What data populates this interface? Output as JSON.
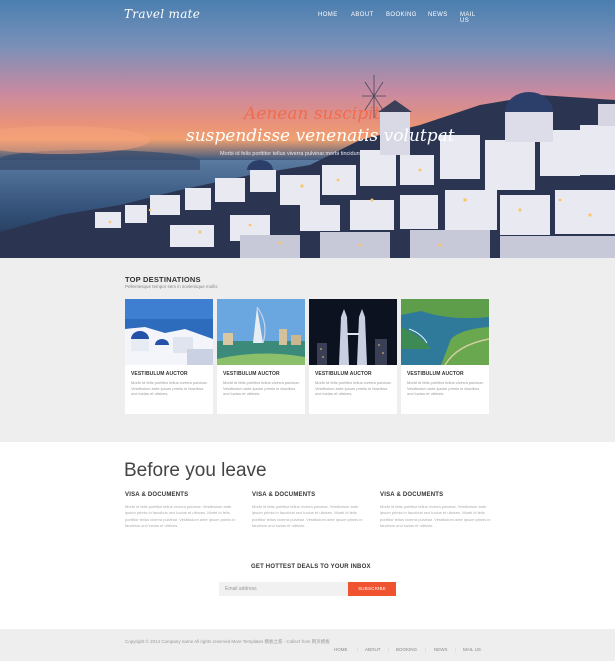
{
  "header": {
    "logo": "Travel mate",
    "nav": [
      "HOME",
      "ABOUT",
      "BOOKING",
      "NEWS",
      "MAIL US"
    ]
  },
  "hero": {
    "title_line1": "Aenean suscipit",
    "title_line2": "suspendisse venenatis volutpat",
    "subtitle": "Morbi id felis porttitor tellus viverra pulvinar.morbi tincidunt"
  },
  "destinations": {
    "title": "TOP DESTINATIONS",
    "subtitle": "Pellentesque tempor sem in scelerisque mollis",
    "cards": [
      {
        "title": "VESTIBULUM AUCTOR",
        "text": "Morbi id felis porttitor tellus viverra pulvinar. Vestibulum ante ipsum primis in faucibus orci luctus et ultrices."
      },
      {
        "title": "VESTIBULUM AUCTOR",
        "text": "Morbi id felis porttitor tellus viverra pulvinar. Vestibulum ante ipsum primis in faucibus orci luctus et ultrices."
      },
      {
        "title": "VESTIBULUM AUCTOR",
        "text": "Morbi id felis porttitor tellus viverra pulvinar. Vestibulum ante ipsum primis in faucibus orci luctus et ultrices."
      },
      {
        "title": "VESTIBULUM AUCTOR",
        "text": "Morbi id felis porttitor tellus viverra pulvinar. Vestibulum ante ipsum primis in faucibus orci luctus et ultrices."
      }
    ]
  },
  "leave": {
    "title": "Before you leave",
    "columns": [
      {
        "heading": "VISA & DOCUMENTS",
        "text": "Morbi id felis porttitor tellus viverra pulvinar. Vestibulum ante ipsum primis in faucibus orci luctus et ultrices. Morbi id felis porttitor tellus viverra pulvinar. Vestibulum ante ipsum primis in faucibus orci luctus et ultrices."
      },
      {
        "heading": "VISA & DOCUMENTS",
        "text": "Morbi id felis porttitor tellus viverra pulvinar. Vestibulum ante ipsum primis in faucibus orci luctus et ultrices. Morbi id felis porttitor tellus viverra pulvinar. Vestibulum ante ipsum primis in faucibus orci luctus et ultrices."
      },
      {
        "heading": "VISA & DOCUMENTS",
        "text": "Morbi id felis porttitor tellus viverra pulvinar. Vestibulum ante ipsum primis in faucibus orci luctus et ultrices. Morbi id felis porttitor tellus viverra pulvinar. Vestibulum ante ipsum primis in faucibus orci luctus et ultrices."
      }
    ]
  },
  "newsletter": {
    "title": "GET HOTTEST DEALS TO YOUR INBOX",
    "placeholder": "Email address",
    "button": "SUBSCRIBE"
  },
  "footer": {
    "copyright": "Copyright © 2014 Company name All rights reserved  More Templates 模板之家  -  Collect from 网页模板",
    "nav": [
      "HOME",
      "ABOUT",
      "BOOKING",
      "NEWS",
      "MAIL US"
    ]
  },
  "colors": {
    "accent": "#f0532f",
    "hero_title_accent": "#f26b4f",
    "section_bg": "#eeeeee"
  }
}
